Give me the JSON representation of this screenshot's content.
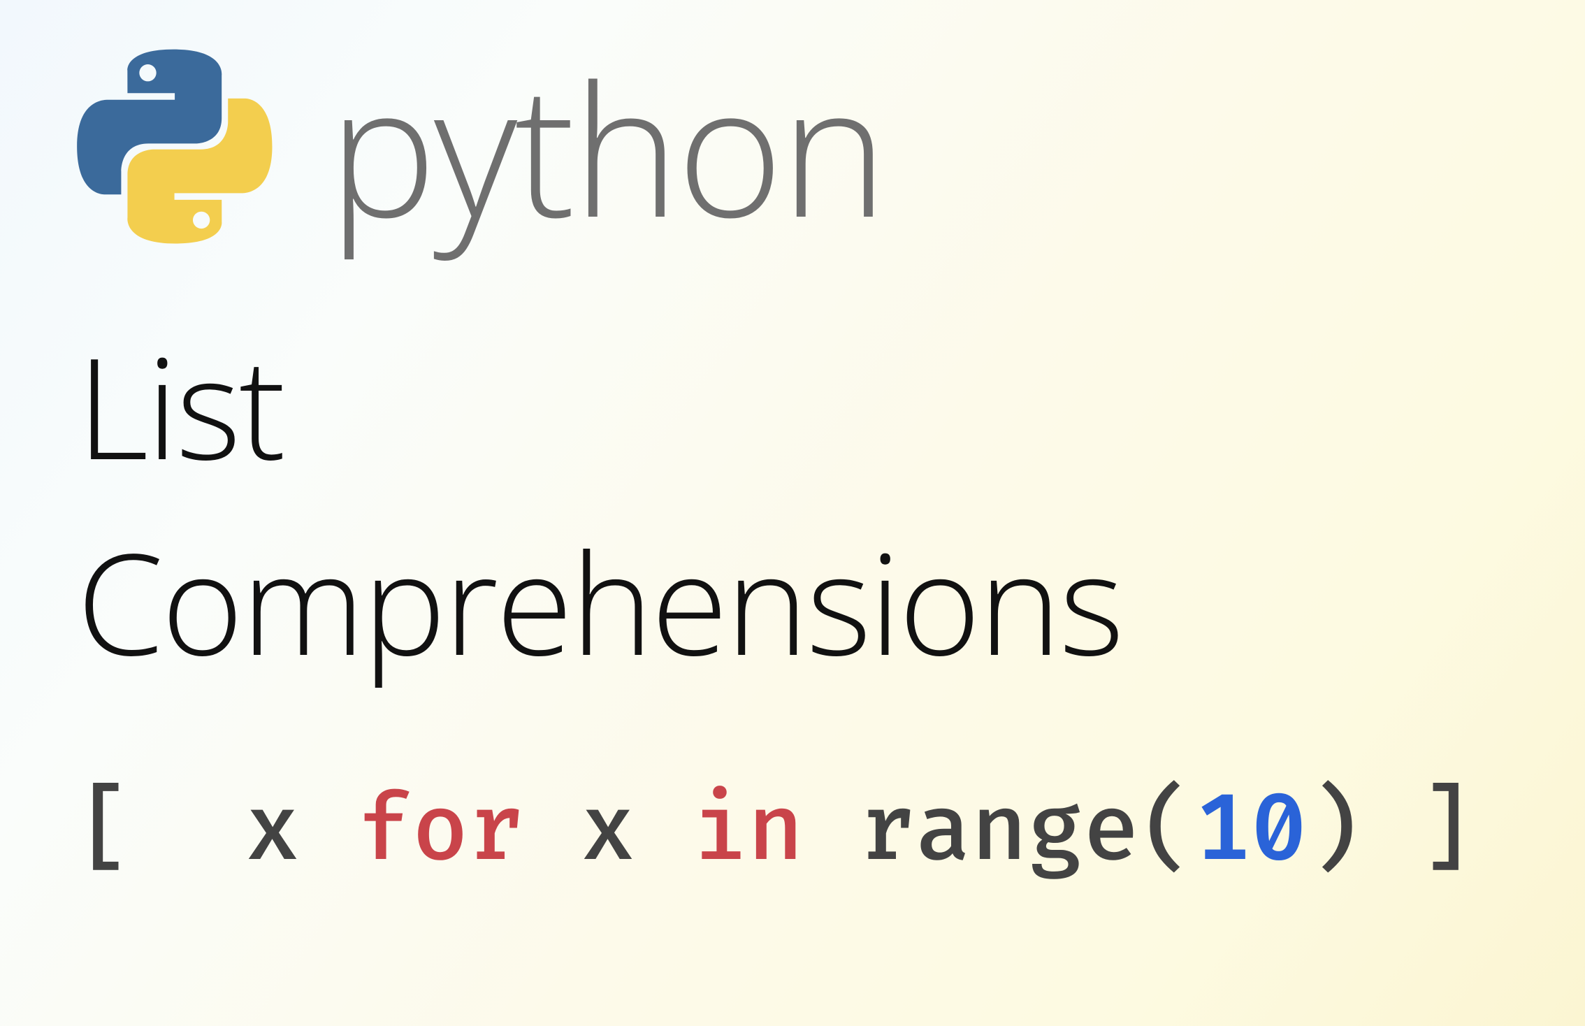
{
  "header": {
    "wordmark": "python",
    "logo_colors": {
      "blue": "#3b6a9b",
      "yellow": "#f3ce4e"
    }
  },
  "title": {
    "line1": "List",
    "line2": "Comprehensions"
  },
  "code": {
    "lbrack": "[",
    "expr_var": "x",
    "kw_for": "for",
    "loop_var": "x",
    "kw_in": "in",
    "func": "range",
    "open_paren": "(",
    "number": "10",
    "close_paren": ")",
    "rbrack": "]"
  }
}
